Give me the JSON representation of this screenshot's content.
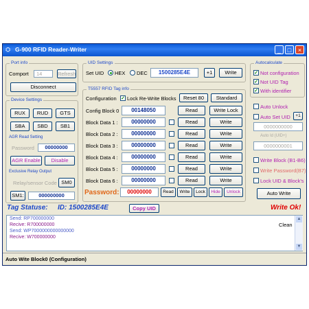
{
  "window": {
    "title": "G-900 RFID Reader-Writer",
    "minimize": "_",
    "maximize": "□",
    "close": "×"
  },
  "port_info": {
    "legend": "Port info",
    "comport_label": "Comport",
    "comport_value": "14",
    "refresh": "Refresh",
    "disconnect": "Disconnect"
  },
  "device_settings": {
    "legend": "Device Settings",
    "buttons": [
      "RUX",
      "RUD",
      "GTS",
      "SBA",
      "SBD",
      "SB1"
    ],
    "agr_label": "AGR Read Setting",
    "password_label": "Password",
    "password_value": "00000000",
    "agr_enable": "AGR Enable",
    "disable": "Disable",
    "relay_legend": "Exclusive Relay Output",
    "relay_code_label": "Relay/sensor Code",
    "sm0": "SM0",
    "sm1": "SM1:",
    "sm1_value": "000000000"
  },
  "uid_settings": {
    "legend": "UID Settings",
    "set_uid_label": "Set UID",
    "hex": "HEX",
    "dec": "DEC",
    "uid_value": "1500285E4E",
    "plus": "+1",
    "write": "Write"
  },
  "t5557": {
    "legend": "T5557 RFID Tag info",
    "config_label": "Configuration",
    "lock_rewrite": "Lock Re-Write Blocks",
    "reset80": "Reset 80",
    "standard": "Standard",
    "config_block_label": "Config Block 0",
    "config_block_value": "00148050",
    "read": "Read",
    "write_lock": "Write Lock",
    "blocks": [
      {
        "label": "Block Data 1 :",
        "value": "00000000",
        "read": "Read",
        "write": "Write"
      },
      {
        "label": "Block Data 2 :",
        "value": "00000000",
        "read": "Read",
        "write": "Write"
      },
      {
        "label": "Block Data 3 :",
        "value": "00000000",
        "read": "Read",
        "write": "Write"
      },
      {
        "label": "Block Data 4 :",
        "value": "00000000",
        "read": "Read",
        "write": "Write"
      },
      {
        "label": "Block Data 5 :",
        "value": "00000000",
        "read": "Read",
        "write": "Write"
      },
      {
        "label": "Block Data 6 :",
        "value": "00000000",
        "read": "Read",
        "write": "Write"
      }
    ],
    "password_label": "Password:",
    "password_value": "00000000",
    "pw_buttons": [
      "Read",
      "Write",
      "Lock",
      "Hide",
      "Unlock"
    ]
  },
  "auto_calc": {
    "legend": "Autocalculate",
    "not_config": "Not configuration",
    "not_uid": "Not UID Tag",
    "with_identifier": "With identifier",
    "auto_unlock": "Auto Unlock",
    "auto_set_uid": "Auto Set UID",
    "plus": "+1",
    "auto_uid_value": "0000000000",
    "auto_id_label": "Auto Id (UID+)",
    "auto_id_value": "0000000001",
    "write_block": "Write Block (B1-B6)",
    "write_password": "Write Password(B7)",
    "lock_uid": "Lock UID & Block's",
    "auto_write": "Auto Write"
  },
  "status": {
    "tag_status_label": "Tag Statuse:",
    "tag_id": "ID: 1500285E4E",
    "copy_uid": "Copy UID",
    "write_ok": "Write Ok!"
  },
  "log": {
    "lines": [
      {
        "text": "Send: RP700000000",
        "color": "#4a5cc8"
      },
      {
        "text": "Recive: R700000000",
        "color": "#8a1a8a"
      },
      {
        "text": "Send: WP7000000000000000",
        "color": "#4a5cc8"
      },
      {
        "text": "Recive: W700000000",
        "color": "#8a1a8a"
      }
    ],
    "clean": "Clean"
  },
  "statusbar": "Auto Wite Block0 (Configuration)",
  "colors": {
    "accent": "#1c47c8",
    "title_bar": "#0a5ad8",
    "orange": "#e0681a",
    "red": "#e00000",
    "magenta": "#b020b0"
  },
  "icons": {
    "app": "rfid-app-icon",
    "check": "✓",
    "spin": "spin-icon"
  }
}
